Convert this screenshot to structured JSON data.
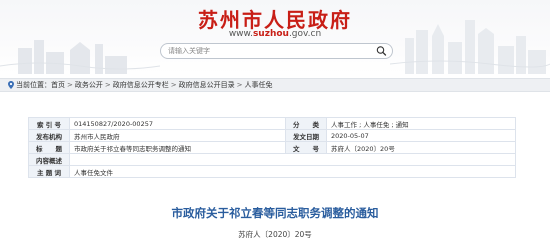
{
  "header": {
    "site_title": "苏州市人民政府",
    "url_prefix": "www.",
    "url_bold": "suzhou",
    "url_suffix": ".gov.cn",
    "brand_color": "#c81e16"
  },
  "search": {
    "placeholder": "请输入关键字",
    "icon": "search-icon"
  },
  "breadcrumb": {
    "prefix": "当前位置：",
    "items": [
      "首页",
      "政务公开",
      "政府信息公开专栏",
      "政府信息公开目录",
      "人事任免"
    ],
    "separator": ">"
  },
  "info_table": {
    "rows": [
      [
        "索 引 号",
        "014150827/2020-00257",
        "分　　类",
        "人事工作 ; 人事任免 ; 通知"
      ],
      [
        "发布机构",
        "苏州市人民政府",
        "发文日期",
        "2020-05-07"
      ],
      [
        "标　　题",
        "市政府关于祁立春等同志职务调整的通知",
        "文　　号",
        "苏府人〔2020〕20号"
      ],
      [
        "内容概述",
        ""
      ],
      [
        "主 题 词",
        "人事任免文件"
      ]
    ]
  },
  "document": {
    "title": "市政府关于祁立春等同志职务调整的通知",
    "number": "苏府人〔2020〕20号",
    "title_color": "#2a5d9e"
  }
}
